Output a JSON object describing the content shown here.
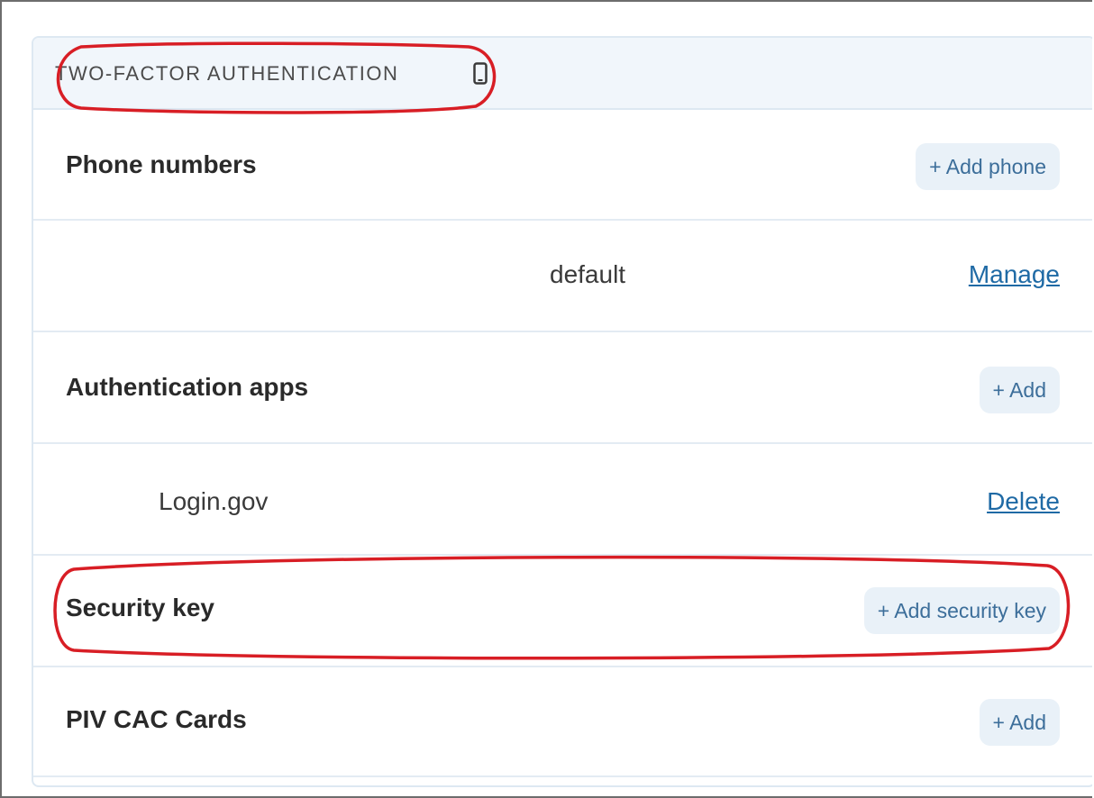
{
  "header": {
    "title": "TWO-FACTOR AUTHENTICATION",
    "icon": "mobile-phone-icon"
  },
  "phone_numbers": {
    "title": "Phone numbers",
    "add_label": "+ Add phone",
    "items": [
      {
        "label": "default",
        "action": "Manage"
      }
    ]
  },
  "auth_apps": {
    "title": "Authentication apps",
    "add_label": "+ Add",
    "items": [
      {
        "label": "Login.gov",
        "action": "Delete"
      }
    ]
  },
  "security_key": {
    "title": "Security key",
    "add_label": "+ Add security key"
  },
  "piv_cac": {
    "title": "PIV CAC Cards",
    "add_label": "+ Add"
  },
  "annotations": {
    "color": "#d81e25"
  },
  "colors": {
    "header_bg": "#f1f6fb",
    "button_bg": "#e9f1f8",
    "button_text": "#3c6e9a",
    "link": "#1f6aa5"
  }
}
